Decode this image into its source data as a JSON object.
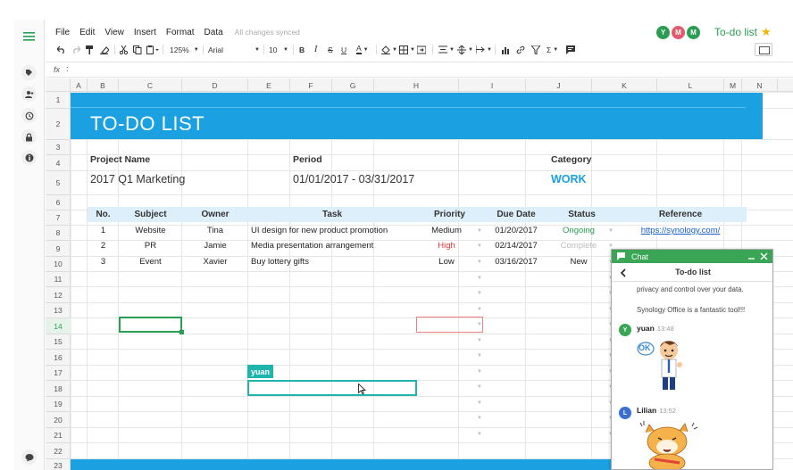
{
  "menu": {
    "items": [
      "File",
      "Edit",
      "View",
      "Insert",
      "Format",
      "Data"
    ],
    "status": "All changes synced"
  },
  "doc": {
    "title": "To-do list",
    "collaborators": [
      {
        "initial": "Y",
        "color": "#2a9d52"
      },
      {
        "initial": "M",
        "color": "#e05b6f"
      },
      {
        "initial": "M",
        "color": "#2a9d52"
      }
    ]
  },
  "toolbar": {
    "zoom": "125%",
    "font": "Arial",
    "size": "10",
    "bold": "B",
    "italic": "I",
    "strike": "S",
    "underline": "U",
    "text_color_glyph": "A",
    "sum": "Σ"
  },
  "formula": {
    "label": "fx",
    "colon": ":"
  },
  "columns": [
    "A",
    "B",
    "C",
    "D",
    "E",
    "F",
    "G",
    "H",
    "I",
    "J",
    "K",
    "L",
    "M",
    "N"
  ],
  "rows": [
    "1",
    "2",
    "3",
    "4",
    "5",
    "6",
    "7",
    "8",
    "9",
    "10",
    "11",
    "12",
    "13",
    "14",
    "15",
    "16",
    "17",
    "18",
    "19",
    "20",
    "21",
    "22",
    "23"
  ],
  "sheet": {
    "title": "TO-DO LIST",
    "project_label": "Project Name",
    "project_value": "2017 Q1 Marketing",
    "period_label": "Period",
    "period_value": "01/01/2017 - 03/31/2017",
    "category_label": "Category",
    "category_value": "WORK",
    "headers": [
      "No.",
      "Subject",
      "Owner",
      "Task",
      "Priority",
      "Due Date",
      "Status",
      "Reference"
    ],
    "tasks": [
      {
        "no": "1",
        "subject": "Website",
        "owner": "Tina",
        "task": "UI design for new product promotion",
        "priority": "Medium",
        "due": "01/20/2017",
        "status": "Ongoing",
        "ref": "https://synology.com/"
      },
      {
        "no": "2",
        "subject": "PR",
        "owner": "Jamie",
        "task": "Media presentation arrangement",
        "priority": "High",
        "due": "02/14/2017",
        "status": "Complete",
        "ref": ""
      },
      {
        "no": "3",
        "subject": "Event",
        "owner": "Xavier",
        "task": "Buy lottery gifts",
        "priority": "Low",
        "due": "03/16/2017",
        "status": "New",
        "ref": ""
      }
    ],
    "collaborator_tag": "yuan"
  },
  "colors": {
    "banner": "#1ba1e2",
    "header_fill": "#ddeffb",
    "accent": "#2a9d52",
    "high": "#e53935",
    "ongoing": "#2a9d52",
    "complete": "#bdbdbd",
    "collab": "#1fb5ad"
  },
  "chat": {
    "title": "Chat",
    "conversation": "To-do list",
    "messages": [
      {
        "text": "privacy and control over your data."
      },
      {
        "text": "Synology Office is a fantastic tool!!!"
      }
    ],
    "users": [
      {
        "name": "yuan",
        "time": "13:48",
        "initial": "Y",
        "color": "#3aa655",
        "sticker_text": "OK"
      },
      {
        "name": "Lilian",
        "time": "13:52",
        "initial": "L",
        "color": "#3b6fd4"
      }
    ]
  }
}
